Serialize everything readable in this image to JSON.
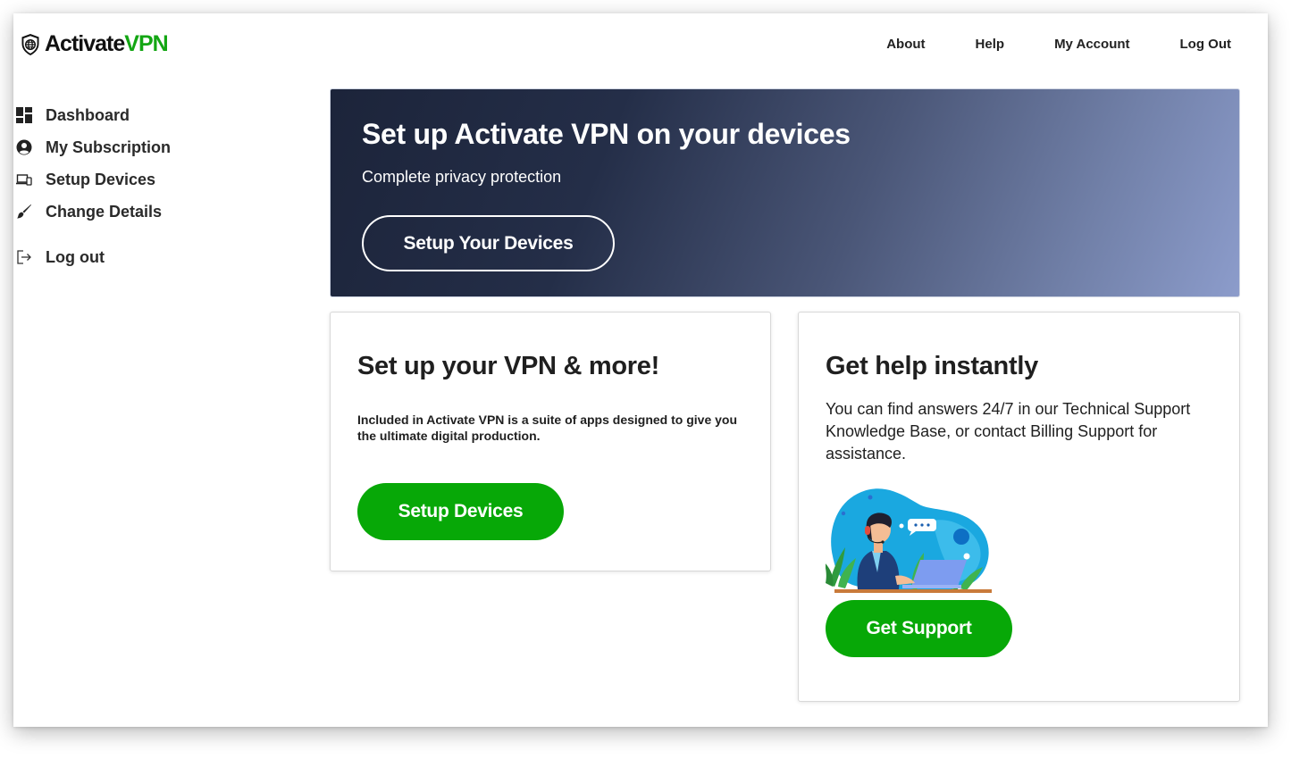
{
  "brand": {
    "name_part1": "Activate",
    "name_part2": "VPN",
    "accent": "#13a613"
  },
  "topnav": [
    {
      "label": "About"
    },
    {
      "label": "Help"
    },
    {
      "label": "My Account"
    },
    {
      "label": "Log Out"
    }
  ],
  "sidebar": {
    "items": [
      {
        "label": "Dashboard",
        "icon": "dashboard-icon"
      },
      {
        "label": "My Subscription",
        "icon": "user-circle-icon"
      },
      {
        "label": "Setup Devices",
        "icon": "devices-icon"
      },
      {
        "label": "Change Details",
        "icon": "brush-icon"
      }
    ],
    "logout": {
      "label": "Log out",
      "icon": "logout-icon"
    }
  },
  "hero": {
    "title": "Set up Activate VPN on your devices",
    "subtitle": "Complete privacy protection",
    "button": "Setup Your Devices"
  },
  "card_setup": {
    "title": "Set up your VPN & more!",
    "description": "Included in Activate VPN is a suite of apps designed to give you the ultimate digital production.",
    "button": "Setup Devices"
  },
  "card_help": {
    "title": "Get help instantly",
    "description": "You can find answers 24/7 in our Technical Support Knowledge Base, or contact Billing Support for assistance.",
    "illustration": "support-agent-illustration",
    "button": "Get Support"
  },
  "colors": {
    "green": "#07a807",
    "hero_dark": "#1c243a",
    "hero_light": "#8c9ccb"
  }
}
